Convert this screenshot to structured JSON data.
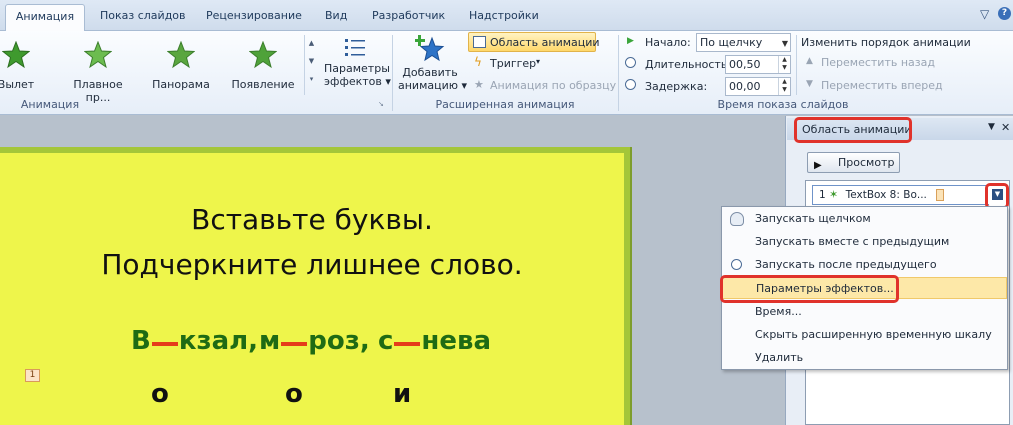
{
  "tabs": {
    "items": [
      "Анимация",
      "Показ слайдов",
      "Рецензирование",
      "Вид",
      "Разработчик",
      "Надстройки"
    ],
    "active_index": 0
  },
  "window_controls": {
    "minimize": "▽",
    "help": "?"
  },
  "ribbon": {
    "animation_group": {
      "label": "Анимация",
      "effects": [
        "Вылет",
        "Плавное пр...",
        "Панорама",
        "Появление"
      ],
      "effect_options_line1": "Параметры",
      "effect_options_line2": "эффектов"
    },
    "advanced_group": {
      "label": "Расширенная анимация",
      "add_line1": "Добавить",
      "add_line2": "анимацию",
      "pane_button": "Область анимации",
      "trigger": "Триггер",
      "painter": "Анимация по образцу"
    },
    "timing_group": {
      "label": "Время показа слайдов",
      "start_label": "Начало:",
      "start_value": "По щелчку",
      "duration_label": "Длительность:",
      "duration_value": "00,50",
      "delay_label": "Задержка:",
      "delay_value": "00,00",
      "reorder_title": "Изменить порядок анимации",
      "move_back": "Переместить назад",
      "move_forward": "Переместить вперед"
    }
  },
  "slide": {
    "line1": "Вставьте буквы.",
    "line2": "Подчеркните лишнее слово.",
    "words": [
      {
        "before": "В",
        "after": "кзал,"
      },
      {
        "before": "м",
        "after": "роз,"
      },
      {
        "before": "с",
        "after": "нева"
      }
    ],
    "letters": [
      "о",
      "о",
      "и"
    ],
    "anim_marker": "1"
  },
  "pane": {
    "title": "Область анимации",
    "close": "✕",
    "preview_label": "Просмотр",
    "item_number": "1",
    "item_label": "TextBox 8: Во..."
  },
  "context_menu": {
    "items": [
      "Запускать щелчком",
      "Запускать вместе с предыдущим",
      "Запускать после предыдущего",
      "Параметры эффектов...",
      "Время...",
      "Скрыть расширенную временную шкалу",
      "Удалить"
    ],
    "highlighted_index": 3
  },
  "colors": {
    "slide_fill": "#eef54b",
    "slide_border": "#a4c639",
    "word_color": "#1f6b14",
    "gap_color": "#e53c1a",
    "highlight_ring": "#e0322b"
  }
}
